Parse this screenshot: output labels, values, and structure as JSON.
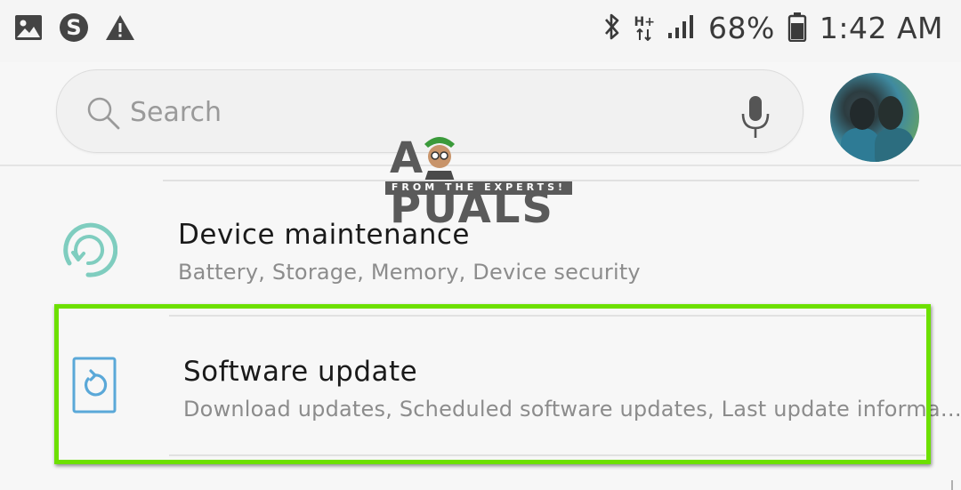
{
  "status_bar": {
    "left_icons": [
      "gallery-icon",
      "skype-icon",
      "warning-icon"
    ],
    "network_type": "H+",
    "battery_percent": "68%",
    "time": "1:42 AM"
  },
  "search": {
    "placeholder": "Search"
  },
  "watermark": {
    "word": "A PUALS",
    "tagline": "FROM THE EXPERTS!"
  },
  "settings_items": [
    {
      "title": "Device maintenance",
      "subtitle": "Battery, Storage, Memory, Device security",
      "icon": "device-maintenance-icon",
      "icon_color": "#7fcdbf"
    },
    {
      "title": "Software update",
      "subtitle": "Download updates, Scheduled software updates, Last update informa…",
      "icon": "software-update-icon",
      "icon_color": "#5aa8d8",
      "highlighted": true
    }
  ],
  "colors": {
    "highlight": "#6de000",
    "background": "#f7f7f7"
  }
}
